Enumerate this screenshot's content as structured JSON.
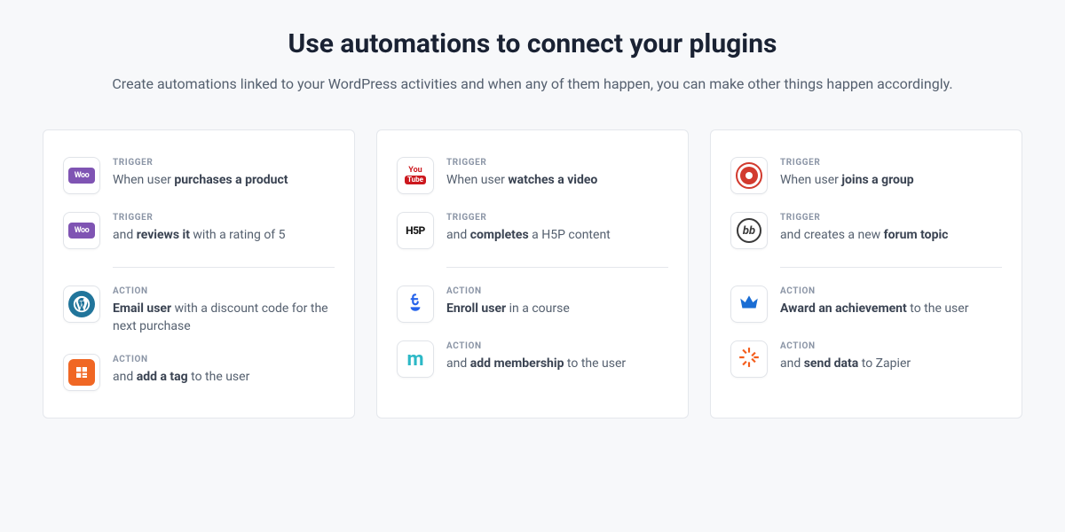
{
  "title": "Use automations to connect your plugins",
  "subtitle": "Create automations linked to your WordPress activities and when any of them happen, you can make other things happen accordingly.",
  "labels": {
    "trigger": "TRIGGER",
    "action": "ACTION"
  },
  "cards": [
    {
      "steps": [
        {
          "type": "trigger",
          "icon": "woocommerce",
          "html": "When user <b>purchases a product</b>"
        },
        {
          "type": "trigger",
          "icon": "woocommerce",
          "html": "and <b>reviews it</b> with a rating of 5"
        },
        {
          "divider": true
        },
        {
          "type": "action",
          "icon": "wordpress",
          "html": "<b>Email user</b> with a discount code for the next purchase"
        },
        {
          "type": "action",
          "icon": "automatorwp",
          "html": "and <b>add a tag</b> to the user"
        }
      ]
    },
    {
      "steps": [
        {
          "type": "trigger",
          "icon": "youtube",
          "html": "When user <b>watches a video</b>"
        },
        {
          "type": "trigger",
          "icon": "h5p",
          "html": "and <b>completes</b> a H5P content"
        },
        {
          "divider": true
        },
        {
          "type": "action",
          "icon": "flask",
          "html": "<b>Enroll user</b> in a course"
        },
        {
          "type": "action",
          "icon": "membership",
          "html": "and <b>add membership</b> to the user"
        }
      ]
    },
    {
      "steps": [
        {
          "type": "trigger",
          "icon": "buddypress",
          "html": "When user <b>joins a group</b>"
        },
        {
          "type": "trigger",
          "icon": "bbpress",
          "html": "and creates a new <b>forum topic</b>"
        },
        {
          "divider": true
        },
        {
          "type": "action",
          "icon": "crown",
          "html": "<b>Award an achievement</b> to the user"
        },
        {
          "type": "action",
          "icon": "zapier",
          "html": "and <b>send data</b> to Zapier"
        }
      ]
    }
  ]
}
